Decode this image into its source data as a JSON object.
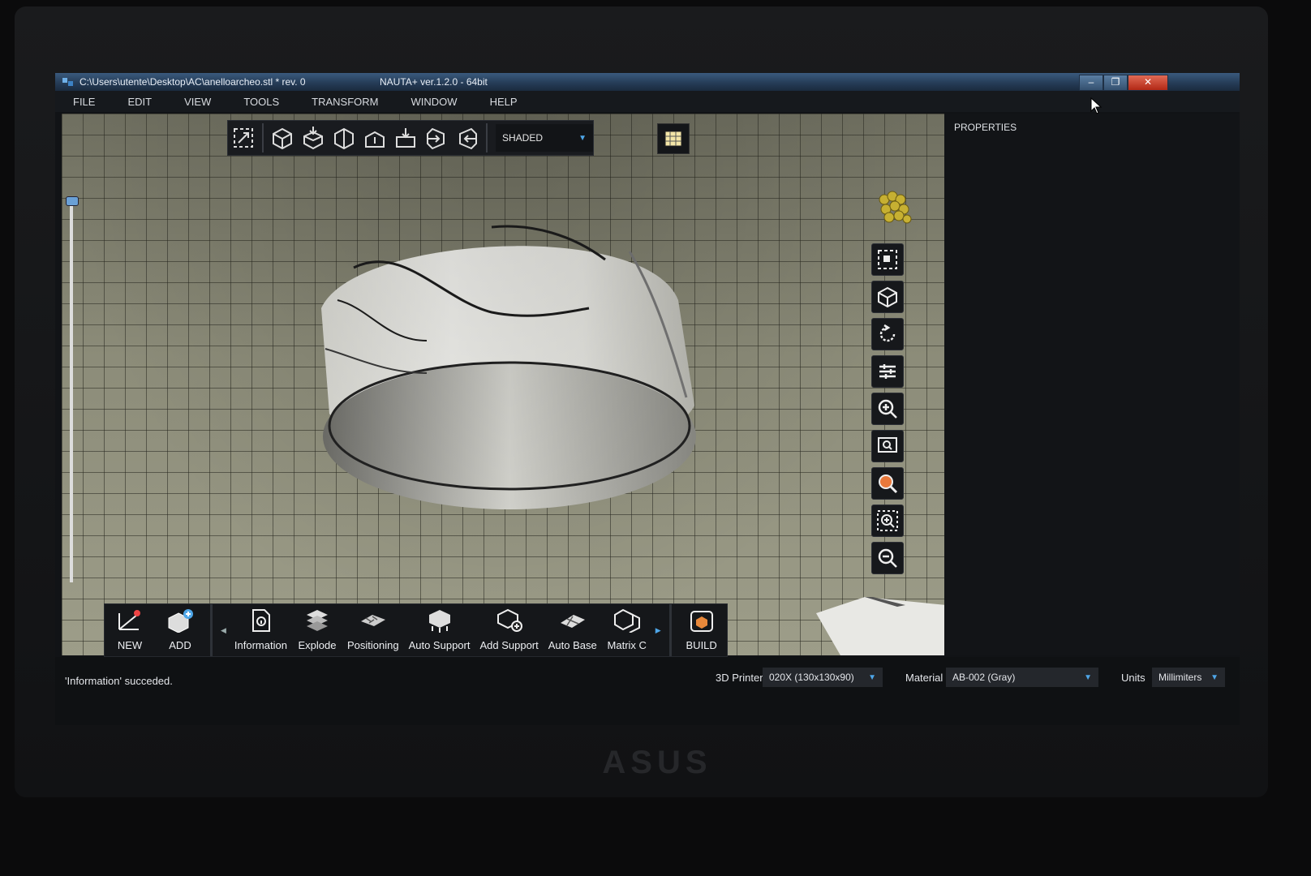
{
  "window": {
    "path": "C:\\Users\\utente\\Desktop\\AC\\anelloarcheo.stl * rev. 0",
    "app_title": "NAUTA+ ver.1.2.0 - 64bit"
  },
  "menu": [
    "FILE",
    "EDIT",
    "VIEW",
    "TOOLS",
    "TRANSFORM",
    "WINDOW",
    "HELP"
  ],
  "view_mode": {
    "value": "SHADED"
  },
  "properties": {
    "title": "PROPERTIES"
  },
  "bottom_toolbar": {
    "items": [
      "NEW",
      "ADD",
      "Information",
      "Explode",
      "Positioning",
      "Auto Support",
      "Add Support",
      "Auto Base",
      "Matrix C",
      "BUILD"
    ]
  },
  "status": {
    "message": "'Information' succeded.",
    "printer_label": "3D Printer",
    "printer_value": "020X (130x130x90)",
    "material_label": "Material",
    "material_value": "AB-002 (Gray)",
    "units_label": "Units",
    "units_value": "Millimiters"
  },
  "brand": "ASUS",
  "colors": {
    "accent": "#4ea6e8",
    "viewport": "#8c8c79",
    "panel": "#121417"
  }
}
